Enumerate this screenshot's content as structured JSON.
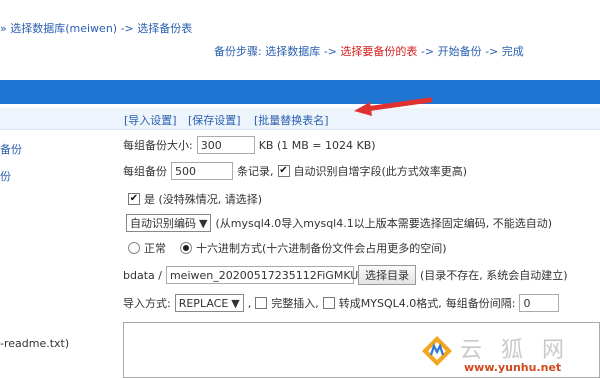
{
  "breadcrumb": "» 选择数据库(meiwen) -> 选择备份表",
  "steps": {
    "prefix": "备份步骤: 选择数据库 -> ",
    "current": "选择要备份的表",
    "suffix": " -> 开始备份 -> 完成"
  },
  "tabs": [
    "[导入设置]",
    "[保存设置]",
    "[批量替换表名]"
  ],
  "left_labels": [
    "备份",
    "份",
    "-readme.txt)"
  ],
  "size_row": {
    "label": "每组备份大小:",
    "value": "300",
    "unit": "KB (1 MB = 1024 KB)"
  },
  "records_row": {
    "label": "每组备份",
    "value": "500",
    "unit": "条记录,",
    "auto_field_label": "自动识别自增字段(此方式效率更高)",
    "auto_field_checked": true
  },
  "yes_row": {
    "label": "是 (没特殊情况, 请选择)",
    "checked": true
  },
  "encoding_row": {
    "select": "自动识别编码",
    "note": "(从mysql4.0导入mysql4.1以上版本需要选择固定编码, 不能选自动)"
  },
  "mode_row": {
    "normal": "正常",
    "hex": "十六进制方式(十六进制备份文件会占用更多的空间)",
    "selected": "hex"
  },
  "dir_row": {
    "prefix": "bdata /",
    "value": "meiwen_20200517235112FiGMKU",
    "button": "选择目录",
    "note": "(目录不存在, 系统会自动建立)"
  },
  "import_row": {
    "label": "导入方式:",
    "select": "REPLACE",
    "complete_insert": "完整插入,",
    "convert": "转成MYSQL4.0格式,",
    "interval_label": "每组备份间隔:",
    "interval_value": "0"
  },
  "watermark": {
    "text": "云 狐 网",
    "url": "www.yunhu.net"
  },
  "colors": {
    "bar": "#1f74d2",
    "link": "#2a5fb0",
    "highlight": "#d61f1f",
    "arrow": "#e0312f"
  }
}
